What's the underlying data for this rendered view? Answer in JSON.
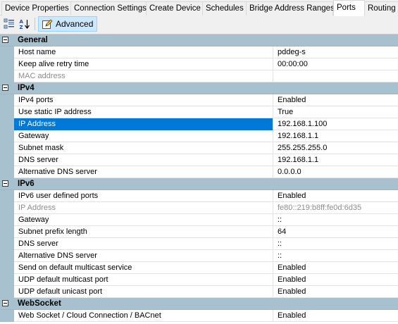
{
  "tabs": [
    {
      "label": "Device Properties"
    },
    {
      "label": "Connection Settings"
    },
    {
      "label": "Create Device"
    },
    {
      "label": "Schedules"
    },
    {
      "label": "Bridge Address Ranges"
    },
    {
      "label": "Ports",
      "active": true
    },
    {
      "label": "Routing"
    }
  ],
  "toolbar": {
    "categorized_icon": "categorized-view-icon",
    "alphabetical_icon": "sort-alphabetical-icon",
    "advanced_label": "Advanced",
    "advanced_icon": "edit-pencil-icon"
  },
  "categories": [
    {
      "name": "General",
      "properties": [
        {
          "name": "Host name",
          "value": "pddeg-s"
        },
        {
          "name": "Keep alive retry time",
          "value": "00:00:00"
        },
        {
          "name": "MAC address",
          "value": "",
          "disabled": true
        }
      ]
    },
    {
      "name": "IPv4",
      "properties": [
        {
          "name": "IPv4 ports",
          "value": "Enabled"
        },
        {
          "name": "Use static IP address",
          "value": "True"
        },
        {
          "name": "IP Address",
          "value": "192.168.1.100",
          "selected": true
        },
        {
          "name": "Gateway",
          "value": "192.168.1.1"
        },
        {
          "name": "Subnet mask",
          "value": "255.255.255.0"
        },
        {
          "name": "DNS server",
          "value": "192.168.1.1"
        },
        {
          "name": "Alternative DNS server",
          "value": "0.0.0.0"
        }
      ]
    },
    {
      "name": "IPv6",
      "properties": [
        {
          "name": "IPv6 user defined ports",
          "value": "Enabled"
        },
        {
          "name": "IP Address",
          "value": "fe80::219:b8ff:fe0d:6d35",
          "disabled": true
        },
        {
          "name": "Gateway",
          "value": "::"
        },
        {
          "name": "Subnet prefix length",
          "value": "64"
        },
        {
          "name": "DNS server",
          "value": "::"
        },
        {
          "name": "Alternative DNS server",
          "value": "::"
        },
        {
          "name": "Send on default multicast service",
          "value": "Enabled"
        },
        {
          "name": "UDP default multicast port",
          "value": "Enabled"
        },
        {
          "name": "UDP default unicast port",
          "value": "Enabled"
        }
      ]
    },
    {
      "name": "WebSocket",
      "properties": [
        {
          "name": "Web Socket / Cloud Connection / BACnet",
          "value": "Enabled"
        }
      ]
    }
  ],
  "colors": {
    "category_bg": "#a8c1cf",
    "selection": "#0078d7",
    "disabled_text": "#8d8d8d"
  }
}
